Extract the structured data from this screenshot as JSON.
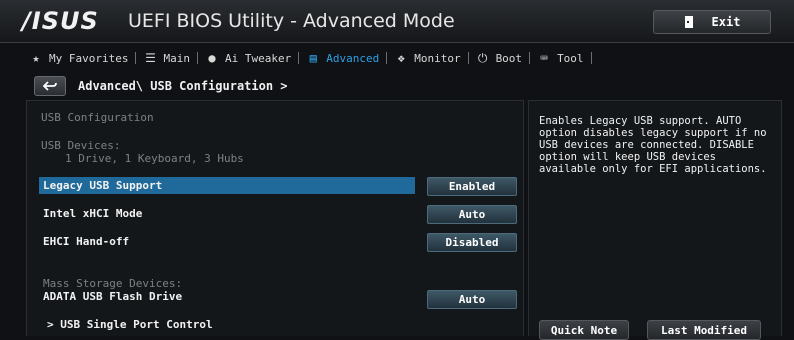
{
  "window": {
    "logo": "/ISUS",
    "title": "UEFI BIOS Utility - Advanced Mode",
    "exit_label": "Exit"
  },
  "nav": {
    "items": [
      {
        "label": "My Favorites",
        "icon": "star-icon"
      },
      {
        "label": "Main",
        "icon": "menu-list-icon"
      },
      {
        "label": "Ai Tweaker",
        "icon": "tweaker-icon"
      },
      {
        "label": "Advanced",
        "icon": "advanced-icon",
        "active": true
      },
      {
        "label": "Monitor",
        "icon": "monitor-icon"
      },
      {
        "label": "Boot",
        "icon": "power-icon"
      },
      {
        "label": "Tool",
        "icon": "tool-icon"
      }
    ]
  },
  "breadcrumb": "Advanced\\ USB Configuration >",
  "main": {
    "section_title": "USB Configuration",
    "devices_label": "USB Devices:",
    "devices_value": "1 Drive, 1 Keyboard, 3 Hubs",
    "options": [
      {
        "label": "Legacy USB Support",
        "value": "Enabled",
        "selected": true
      },
      {
        "label": "Intel xHCI Mode",
        "value": "Auto"
      },
      {
        "label": "EHCI Hand-off",
        "value": "Disabled"
      }
    ],
    "mass_storage_label": "Mass Storage Devices:",
    "mass_storage_device": {
      "label": "ADATA USB Flash Drive",
      "value": "Auto"
    },
    "submenu": "> USB Single Port Control"
  },
  "help": {
    "text": "Enables Legacy USB support. AUTO option disables legacy support if no USB devices are connected. DISABLE option will keep USB devices available only for EFI applications.",
    "quick_note": "Quick Note",
    "last_modified": "Last Modified"
  },
  "colors": {
    "accent": "#2ea0e6",
    "selection": "#1f6a9a",
    "background": "#0f1114"
  }
}
